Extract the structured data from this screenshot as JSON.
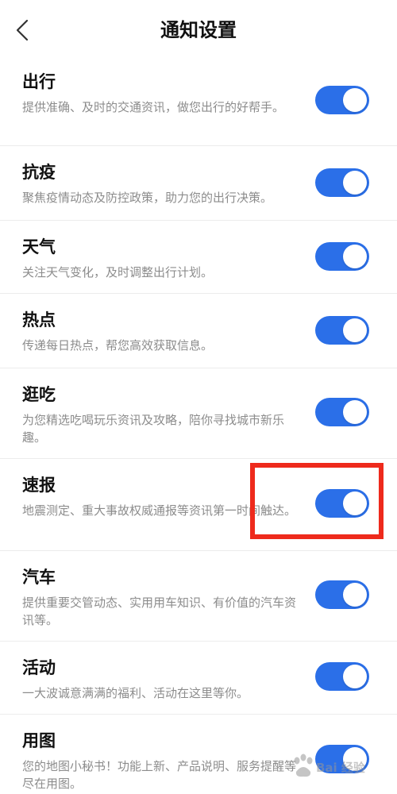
{
  "header": {
    "title": "通知设置"
  },
  "settings": [
    {
      "title": "出行",
      "description": "提供准确、及时的交通资讯，做您出行的好帮手。",
      "enabled": true
    },
    {
      "title": "抗疫",
      "description": "聚焦疫情动态及防控政策，助力您的出行决策。",
      "enabled": true
    },
    {
      "title": "天气",
      "description": "关注天气变化，及时调整出行计划。",
      "enabled": true
    },
    {
      "title": "热点",
      "description": "传递每日热点，帮您高效获取信息。",
      "enabled": true
    },
    {
      "title": "逛吃",
      "description": "为您精选吃喝玩乐资讯及攻略，陪你寻找城市新乐趣。",
      "enabled": true
    },
    {
      "title": "速报",
      "description": "地震测定、重大事故权威通报等资讯第一时间触达。",
      "enabled": true
    },
    {
      "title": "汽车",
      "description": "提供重要交管动态、实用用车知识、有价值的汽车资讯等。",
      "enabled": true
    },
    {
      "title": "活动",
      "description": "一大波诚意满满的福利、活动在这里等你。",
      "enabled": true
    },
    {
      "title": "用图",
      "description": "您的地图小秘书！功能上新、产品说明、服务提醒等尽在用图。",
      "enabled": true
    }
  ],
  "colors": {
    "toggle_on": "#2b6fe8",
    "highlight": "#ee2a1c"
  },
  "watermark": {
    "text": "Bai 经验"
  }
}
